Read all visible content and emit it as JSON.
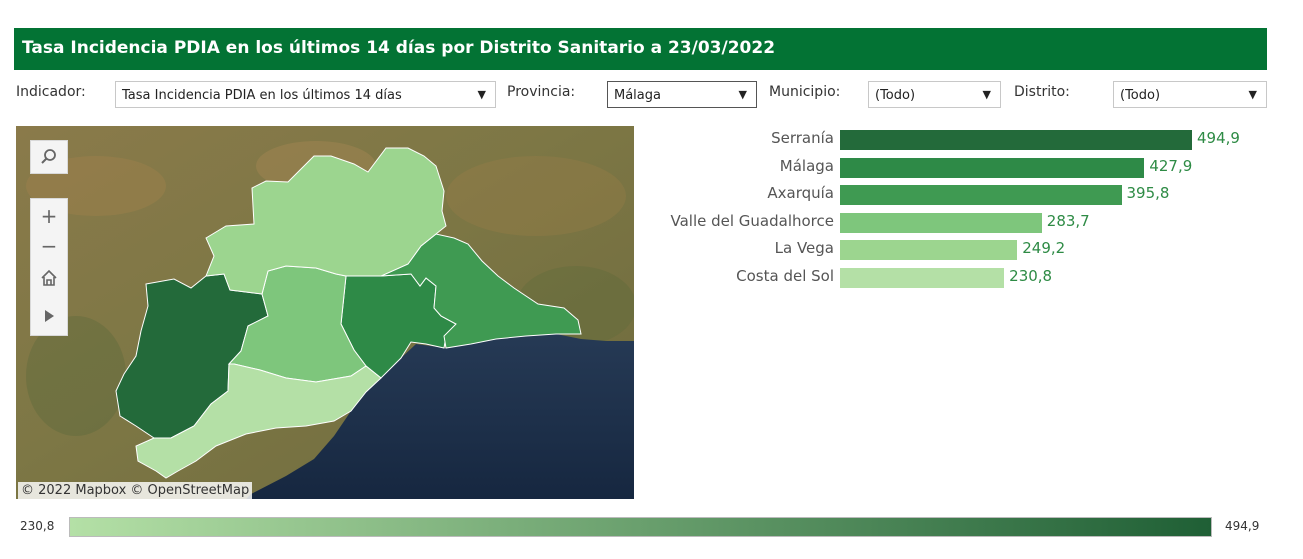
{
  "title": "Tasa Incidencia PDIA en los últimos 14 días por Distrito Sanitario a 23/03/2022",
  "filters": {
    "indicador": {
      "label": "Indicador:",
      "value": "Tasa Incidencia PDIA en los últimos 14 días"
    },
    "provincia": {
      "label": "Provincia:",
      "value": "Málaga"
    },
    "municipio": {
      "label": "Municipio:",
      "value": "(Todo)"
    },
    "distrito": {
      "label": "Distrito:",
      "value": "(Todo)"
    }
  },
  "map": {
    "attribution": "© 2022 Mapbox  © OpenStreetMap",
    "controls": [
      "search-icon",
      "zoom-in-icon",
      "zoom-out-icon",
      "home-icon",
      "play-icon"
    ]
  },
  "chart_data": {
    "type": "bar",
    "orientation": "horizontal",
    "categories": [
      "Serranía",
      "Málaga",
      "Axarquía",
      "Valle del Guadalhorce",
      "La Vega",
      "Costa del Sol"
    ],
    "values": [
      494.9,
      427.9,
      395.8,
      283.7,
      249.2,
      230.8
    ],
    "value_labels": [
      "494,9",
      "427,9",
      "395,8",
      "283,7",
      "249,2",
      "230,8"
    ],
    "colors": [
      "#236a3a",
      "#2e8a47",
      "#3f9a52",
      "#7ec67c",
      "#9cd58f",
      "#b4e0a6"
    ]
  },
  "legend": {
    "min_label": "230,8",
    "max_label": "494,9",
    "color_start": "#b4e0a6",
    "color_end": "#1f5f35"
  },
  "colors": {
    "header": "#037334",
    "value_text": "#2e8b45"
  }
}
